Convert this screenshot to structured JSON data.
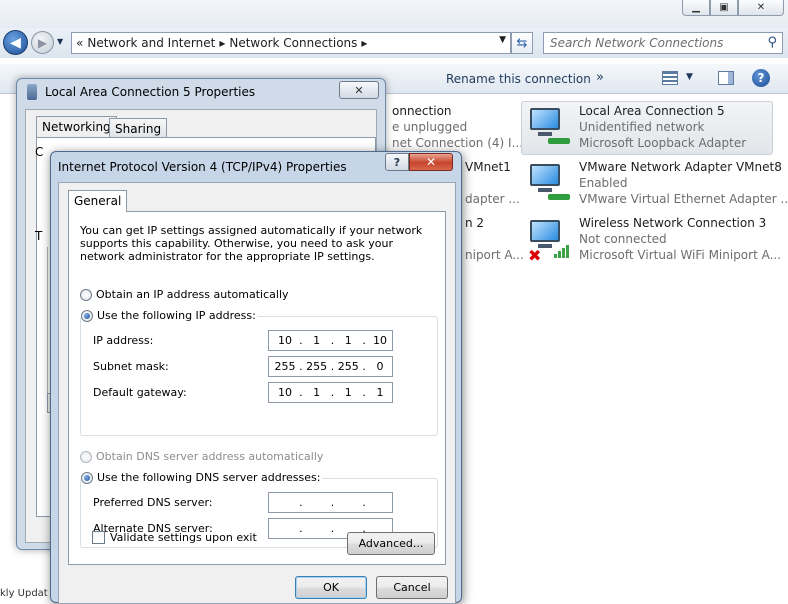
{
  "explorer": {
    "breadcrumb": [
      "«",
      "Network and Internet",
      "▸",
      "Network Connections",
      "▸"
    ],
    "search_placeholder": "Search Network Connections",
    "toolbar": {
      "rename": "Rename this connection",
      "more": "»"
    },
    "partial_texts": {
      "c1_l1": "onnection",
      "c1_l2": "e unplugged",
      "c1_l3": "net Connection (4) I...",
      "c2_l1": "VMnet1",
      "c2_l3": "dapter ...",
      "c3_l1": "n 2",
      "c3_l3": "niport A...",
      "taskbar": "kly Updat"
    },
    "connections": [
      {
        "name": "Local Area Connection 5",
        "status": "Unidentified network",
        "adapter": "Microsoft Loopback Adapter"
      },
      {
        "name": "VMware Network Adapter VMnet8",
        "status": "Enabled",
        "adapter": "VMware Virtual Ethernet Adapter ..."
      },
      {
        "name": "Wireless Network Connection 3",
        "status": "Not connected",
        "adapter": "Microsoft Virtual WiFi Miniport A..."
      }
    ]
  },
  "back_dialog": {
    "title": "Local Area Connection 5 Properties",
    "tabs": [
      "Networking",
      "Sharing"
    ],
    "fragment_c": "C",
    "fragment_t": "T"
  },
  "ipv4_dialog": {
    "title": "Internet Protocol Version 4 (TCP/IPv4) Properties",
    "tab": "General",
    "description": "You can get IP settings assigned automatically if your network supports this capability. Otherwise, you need to ask your network administrator for the appropriate IP settings.",
    "obtain_ip_auto": "Obtain an IP address automatically",
    "use_following_ip": "Use the following IP address:",
    "ip_address_label": "IP address:",
    "ip_address": [
      "10",
      "1",
      "1",
      "10"
    ],
    "subnet_mask_label": "Subnet mask:",
    "subnet_mask": [
      "255",
      "255",
      "255",
      "0"
    ],
    "default_gateway_label": "Default gateway:",
    "default_gateway": [
      "10",
      "1",
      "1",
      "1"
    ],
    "obtain_dns_auto": "Obtain DNS server address automatically",
    "use_following_dns": "Use the following DNS server addresses:",
    "preferred_dns_label": "Preferred DNS server:",
    "preferred_dns": [
      "",
      "",
      "",
      ""
    ],
    "alternate_dns_label": "Alternate DNS server:",
    "alternate_dns": [
      "",
      "",
      "",
      ""
    ],
    "validate_label": "Validate settings upon exit",
    "advanced_button": "Advanced...",
    "ok_button": "OK",
    "cancel_button": "Cancel"
  }
}
